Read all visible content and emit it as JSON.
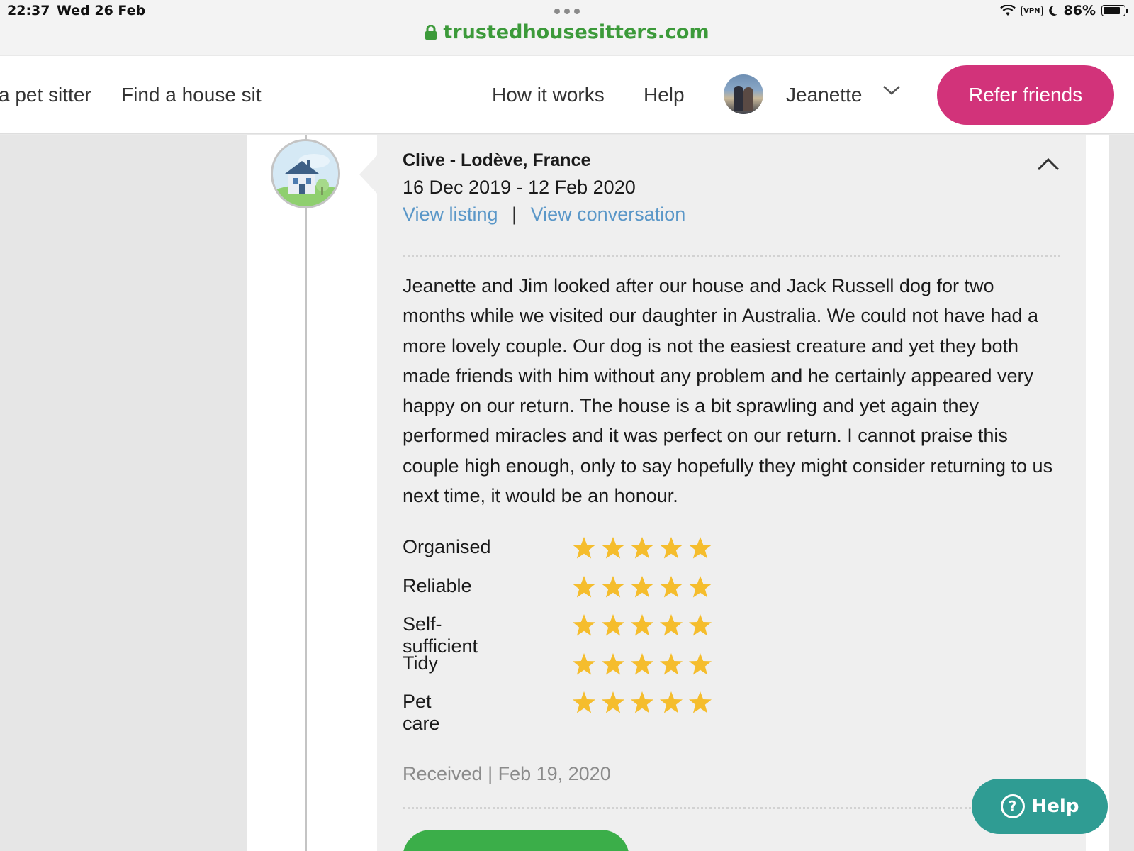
{
  "status_bar": {
    "time": "22:37",
    "date": "Wed 26 Feb",
    "vpn": "VPN",
    "battery": "86%",
    "battery_level": 0.86
  },
  "browser": {
    "url": "trustedhousesitters.com"
  },
  "nav": {
    "find_pet_sitter": "a pet sitter",
    "find_house_sit": "Find a house sit",
    "how_it_works": "How it works",
    "help": "Help",
    "user_name": "Jeanette",
    "refer_friends": "Refer friends"
  },
  "review": {
    "reviewer": "Clive - Lodève, France",
    "dates": "16 Dec 2019 - 12 Feb 2020",
    "view_listing": "View listing",
    "separator": "|",
    "view_conversation": "View conversation",
    "text": "Jeanette and Jim looked after our house and Jack Russell dog for two months while we visited our daughter in Australia. We could not have had a more lovely couple. Our dog is not the easiest creature and yet they both made friends with him without any problem and he certainly appeared very happy on our return. The house is a bit sprawling and yet again they performed miracles and it was perfect on our return. I cannot praise this couple high enough, only to say hopefully they might consider returning to us next time, it would be an honour.",
    "ratings": [
      {
        "label": "Organised",
        "stars": 5
      },
      {
        "label": "Reliable",
        "stars": 5
      },
      {
        "label": "Self-sufficient",
        "stars": 5
      },
      {
        "label": "Tidy",
        "stars": 5
      },
      {
        "label": "Pet care",
        "stars": 5
      }
    ],
    "max_stars": 5,
    "received": "Received | Feb 19, 2020"
  },
  "help_widget": {
    "label": "Help"
  },
  "colors": {
    "brand_green": "#3c9a3a",
    "refer_pink": "#d2337a",
    "link_blue": "#5a97c8",
    "star_yellow": "#f5bd2d",
    "help_teal": "#2f9c93",
    "cta_green": "#3bae49"
  },
  "icons": {
    "lock": "lock-icon",
    "wifi": "wifi-icon",
    "moon": "moon-icon",
    "battery": "battery-icon",
    "chevron_down": "chevron-down-icon",
    "chevron_up": "chevron-up-icon",
    "star": "star-icon",
    "house": "house-icon",
    "help": "question-icon"
  }
}
